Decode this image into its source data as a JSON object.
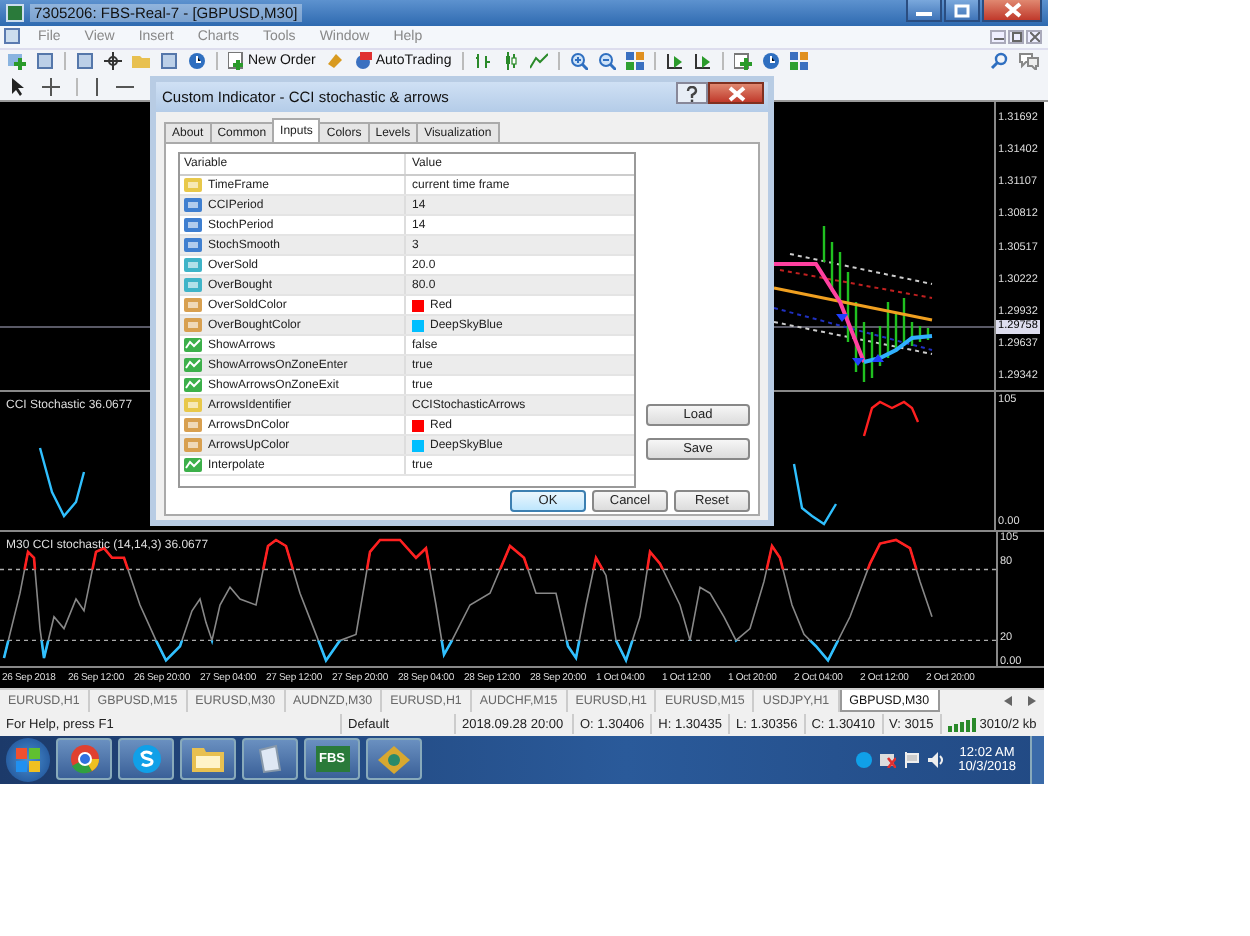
{
  "window": {
    "title": "7305206: FBS-Real-7 - [GBPUSD,M30]"
  },
  "menu": [
    "File",
    "View",
    "Insert",
    "Charts",
    "Tools",
    "Window",
    "Help"
  ],
  "toolbar": {
    "buttons": [
      "New Order",
      "AutoTrading"
    ]
  },
  "chart": {
    "price_labels": [
      "1.31692",
      "1.31402",
      "1.31107",
      "1.30812",
      "1.30517",
      "1.30222",
      "1.29932",
      "1.29637",
      "1.29342"
    ],
    "current_price": "1.29758",
    "subwindows": [
      {
        "label": "CCI Stochastic 36.0677",
        "axis": [
          "105",
          "0.00"
        ]
      },
      {
        "label": "M30 CCI stochastic (14,14,3) 36.0677",
        "axis": [
          "105",
          "80",
          "20",
          "0.00"
        ]
      }
    ],
    "time_labels": [
      "26 Sep 2018",
      "26 Sep 12:00",
      "26 Sep 20:00",
      "27 Sep 04:00",
      "27 Sep 12:00",
      "27 Sep 20:00",
      "28 Sep 04:00",
      "28 Sep 12:00",
      "28 Sep 20:00",
      "1 Oct 04:00",
      "1 Oct 12:00",
      "1 Oct 20:00",
      "2 Oct 04:00",
      "2 Oct 12:00",
      "2 Oct 20:00"
    ]
  },
  "chart_tabs": [
    {
      "label": "EURUSD,H1",
      "selected": false
    },
    {
      "label": "GBPUSD,M15",
      "selected": false
    },
    {
      "label": "EURUSD,M30",
      "selected": false
    },
    {
      "label": "AUDNZD,M30",
      "selected": false
    },
    {
      "label": "EURUSD,H1",
      "selected": false
    },
    {
      "label": "AUDCHF,M15",
      "selected": false
    },
    {
      "label": "EURUSD,H1",
      "selected": false
    },
    {
      "label": "EURUSD,M15",
      "selected": false
    },
    {
      "label": "USDJPY,H1",
      "selected": false
    },
    {
      "label": "GBPUSD,M30",
      "selected": true
    }
  ],
  "status_bar": [
    "For Help, press F1",
    "Default",
    "2018.09.28 20:00",
    "O: 1.30406",
    "H: 1.30435",
    "L: 1.30356",
    "C: 1.30410",
    "V: 3015",
    "3010/2 kb"
  ],
  "taskbar": {
    "apps": [
      {
        "kind": "start"
      },
      {
        "kind": "chrome"
      },
      {
        "kind": "skype"
      },
      {
        "kind": "folder"
      },
      {
        "kind": "notepad"
      },
      {
        "kind": "fbs",
        "label": "FBS"
      },
      {
        "kind": "app"
      }
    ],
    "time": "12:02 AM",
    "date": "10/3/2018"
  },
  "dialog": {
    "title": "Custom Indicator - CCI stochastic & arrows",
    "tabs": [
      {
        "label": "About",
        "selected": false
      },
      {
        "label": "Common",
        "selected": false
      },
      {
        "label": "Inputs",
        "selected": true
      },
      {
        "label": "Colors",
        "selected": false
      },
      {
        "label": "Levels",
        "selected": false
      },
      {
        "label": "Visualization",
        "selected": false
      }
    ],
    "columns": [
      "Variable",
      "Value"
    ],
    "rows": [
      {
        "kind": "string",
        "name": "TimeFrame",
        "value": "current time frame"
      },
      {
        "kind": "int",
        "name": "CCIPeriod",
        "value": "14"
      },
      {
        "kind": "int",
        "name": "StochPeriod",
        "value": "14"
      },
      {
        "kind": "int",
        "name": "StochSmooth",
        "value": "3"
      },
      {
        "kind": "double",
        "name": "OverSold",
        "value": "20.0"
      },
      {
        "kind": "double",
        "name": "OverBought",
        "value": "80.0"
      },
      {
        "kind": "color",
        "name": "OverSoldColor",
        "value": "Red",
        "color": "#ff0000"
      },
      {
        "kind": "color",
        "name": "OverBoughtColor",
        "value": "DeepSkyBlue",
        "color": "#00bfff"
      },
      {
        "kind": "bool",
        "name": "ShowArrows",
        "value": "false"
      },
      {
        "kind": "bool",
        "name": "ShowArrowsOnZoneEnter",
        "value": "true"
      },
      {
        "kind": "bool",
        "name": "ShowArrowsOnZoneExit",
        "value": "true"
      },
      {
        "kind": "string",
        "name": "ArrowsIdentifier",
        "value": "CCIStochasticArrows"
      },
      {
        "kind": "color",
        "name": "ArrowsDnColor",
        "value": "Red",
        "color": "#ff0000"
      },
      {
        "kind": "color",
        "name": "ArrowsUpColor",
        "value": "DeepSkyBlue",
        "color": "#00bfff"
      },
      {
        "kind": "bool",
        "name": "Interpolate",
        "value": "true"
      }
    ],
    "side_buttons": [
      "Load",
      "Save"
    ],
    "buttons": [
      "OK",
      "Cancel",
      "Reset"
    ]
  }
}
